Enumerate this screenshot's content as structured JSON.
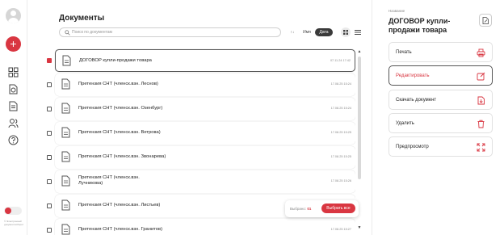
{
  "rail": {
    "note": "© Электронный документооборот"
  },
  "header": {
    "title": "Документы",
    "search_placeholder": "Поиск по документам",
    "sort_dir": "↑↓",
    "sort_name": "Имя",
    "sort_date": "Дата"
  },
  "documents": [
    {
      "name": "ДОГОВОР купли-продажи товара",
      "date": "07.11.24 17:42",
      "selected": true
    },
    {
      "name": "Претензия СНТ (членск.взн. Леснов)",
      "date": "17.08.25 15:24",
      "selected": false
    },
    {
      "name": "Претензия СНТ (членск.взн. Озенбург)",
      "date": "17.08.25 15:24",
      "selected": false
    },
    {
      "name": "Претензия СНТ (членск.взн. Ветрова)",
      "date": "17.08.25 15:25",
      "selected": false
    },
    {
      "name": "Претензия СНТ (членск.взн. Звонарева)",
      "date": "17.08.25 15:25",
      "selected": false
    },
    {
      "name": "Претензия СНТ (членск.взн. Лучникова)",
      "date": "17.08.25 15:26",
      "selected": false
    },
    {
      "name": "Претензия СНТ (членск.взн. Листьев)",
      "date": "17.08.25 15:26",
      "selected": false
    },
    {
      "name": "Претензия СНТ (членск.взн. Гранитов)",
      "date": "17.08.25 15:27",
      "selected": false
    }
  ],
  "selection": {
    "label": "Выбрано:",
    "count": "01",
    "select_all": "Выбрать все"
  },
  "panel": {
    "label": "Название",
    "title": "ДОГОВОР купли-продажи товара",
    "actions": [
      {
        "label": "Печать",
        "icon": "printer-icon"
      },
      {
        "label": "Редактировать",
        "icon": "edit-icon"
      },
      {
        "label": "Скачать документ",
        "icon": "download-icon"
      },
      {
        "label": "Удалить",
        "icon": "trash-icon"
      },
      {
        "label": "Предпросмотр",
        "icon": "expand-icon"
      }
    ]
  },
  "colors": {
    "accent": "#d93641",
    "dark": "#3a3a3a"
  }
}
